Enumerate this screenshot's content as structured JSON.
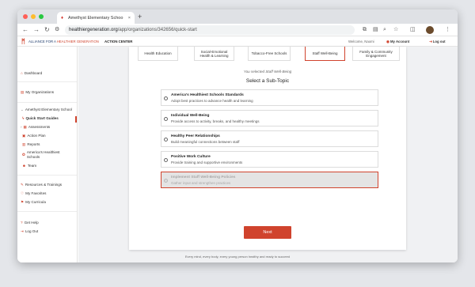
{
  "browser": {
    "tab_title": "Amethyst Elementary Schoo",
    "tab_close": "×",
    "new_tab": "+",
    "url_domain": "healthiergeneration.org",
    "url_path": "/app/organizations/342656/quick-start",
    "colors": {
      "close": "#ff5f57",
      "minimize": "#febc2e",
      "maximize": "#28c840"
    }
  },
  "header": {
    "brand_prefix": "ALLIANCE FOR A ",
    "brand_highlight": "HEALTHIER GENERATION",
    "section": "ACTION CENTER",
    "welcome": "Welcome, Naomi",
    "my_account": "My Account",
    "log_out": "Log out"
  },
  "sidebar": {
    "dashboard": "Dashboard",
    "my_organizations": "My Organizations",
    "org_name": "Amethyst Elementary School",
    "quick_start": "Quick Start Guides",
    "assessments": "Assessments",
    "action_plan": "Action Plan",
    "reports": "Reports",
    "ahs_line1": "America's Healthiest",
    "ahs_line2": "Schools",
    "team": "Team",
    "resources": "Resources & Trainings",
    "favorites": "My Favorites",
    "curricula": "My Curricula",
    "get_help": "Get Help",
    "log_out": "Log Out"
  },
  "topics": [
    {
      "line1": "Health Education",
      "line2": ""
    },
    {
      "line1": "Social-Emotional",
      "line2": "Health & Learning"
    },
    {
      "line1": "Tobacco-Free Schools",
      "line2": ""
    },
    {
      "line1": "Staff Well-Being",
      "line2": ""
    },
    {
      "line1": "Family & Community",
      "line2": "Engagement"
    }
  ],
  "main": {
    "you_selected": "You selected Staff Well-Being",
    "select_title": "Select a Sub-Topic",
    "options": [
      {
        "title": "America's Healthiest Schools Standards",
        "desc": "Adopt best practices to advance health and learning"
      },
      {
        "title": "Individual Well-Being",
        "desc": "Provide access to activity, breaks, and healthy meetings"
      },
      {
        "title": "Healthy Peer Relationships",
        "desc": "Build meaningful connections between staff"
      },
      {
        "title": "Positive Work Culture",
        "desc": "Provide training and supportive environments"
      },
      {
        "title": "Implement Staff Well-Being Policies",
        "desc": "Gather input and strengthen practices"
      }
    ],
    "next_label": "Next"
  },
  "footer": "Every mind, every body, every young person healthy and ready to succeed",
  "accent_color": "#d0432d"
}
